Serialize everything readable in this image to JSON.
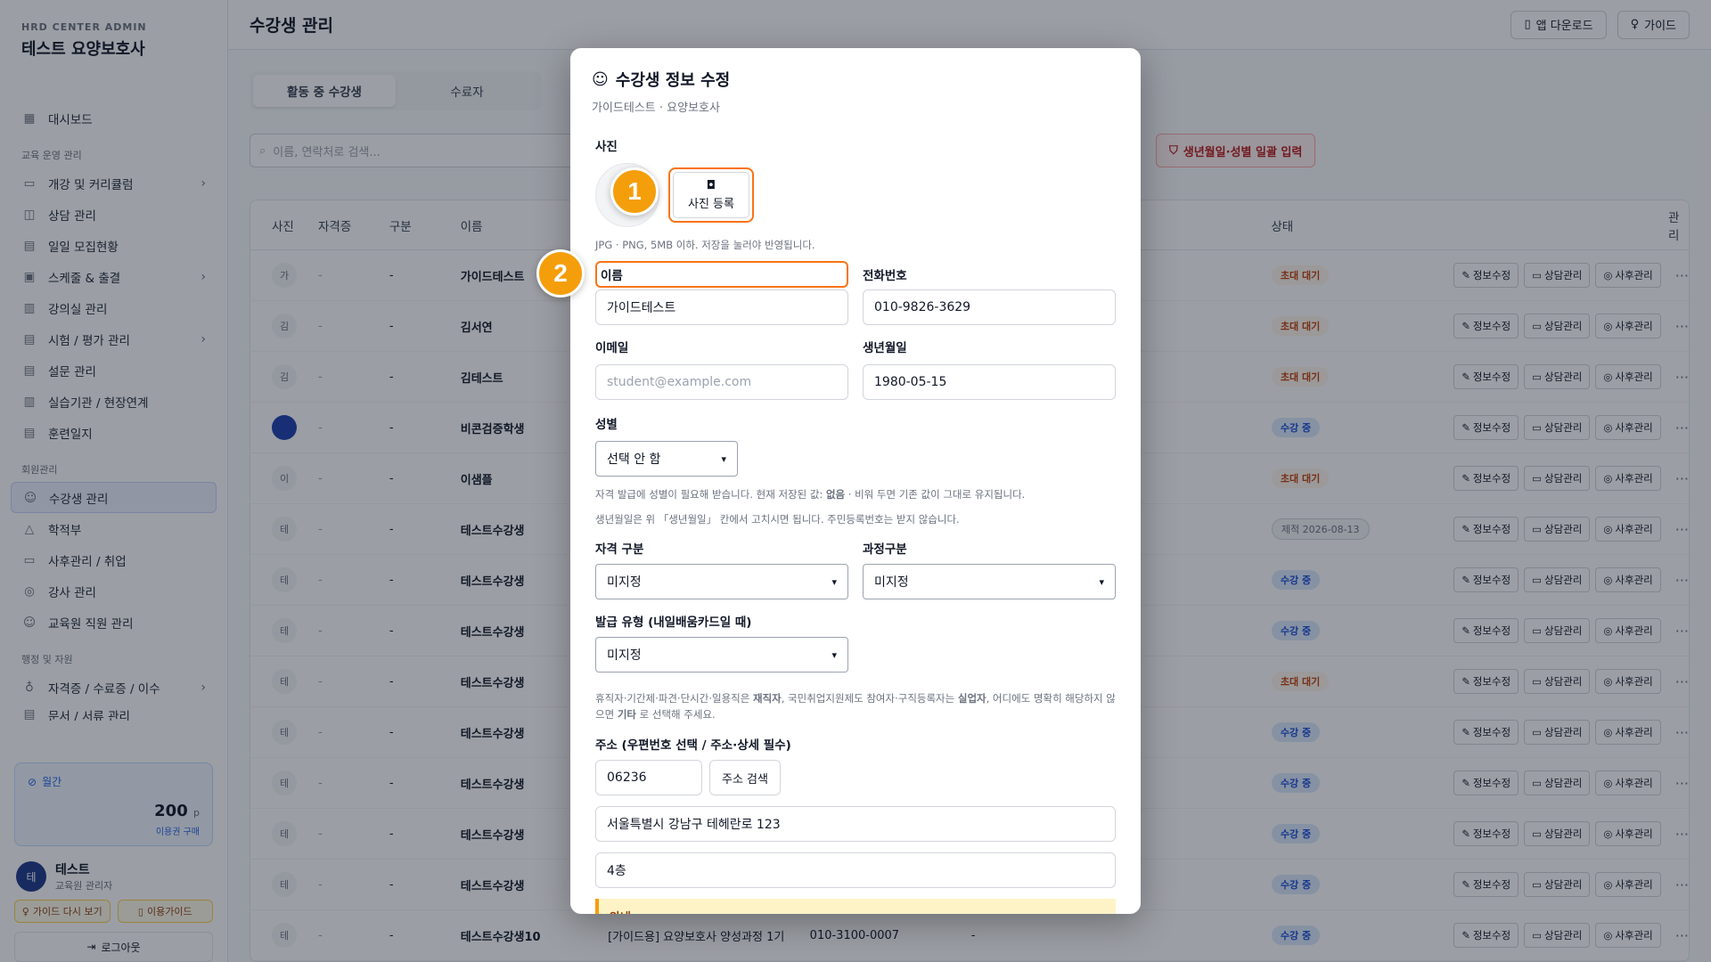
{
  "brand": {
    "sub": "HRD CENTER ADMIN",
    "title": "테스트 요양보호사"
  },
  "nav": {
    "dashboard": "대시보드",
    "group_edu": "교육 운영 관리",
    "course": "개강 및 커리큘럼",
    "consult": "상담 관리",
    "daily": "일일 모집현황",
    "schedule": "스케줄 & 출결",
    "classroom": "강의실 관리",
    "exam": "시험 / 평가 관리",
    "survey": "설문 관리",
    "practice": "실습기관 / 현장연계",
    "journal": "훈련일지",
    "group_member": "회원관리",
    "students": "수강생 관리",
    "registry": "학적부",
    "aftercare": "사후관리 / 취업",
    "instructors": "강사 관리",
    "staff": "교육원 직원 관리",
    "group_admin": "행정 및 자원",
    "certs": "자격증 / 수료증 / 이수",
    "docs": "문서 / 서류 관리"
  },
  "plan": {
    "label": "월간",
    "points": "200",
    "unit": "p",
    "link": "이용권 구매"
  },
  "user": {
    "initial": "테",
    "name": "테스트",
    "role": "교육원 관리자"
  },
  "sidebar_buttons": {
    "guide_again": "가이드 다시 보기",
    "usage_guide": "이용가이드",
    "logout": "로그아웃"
  },
  "header": {
    "title": "수강생 관리",
    "app_download": "앱 다운로드",
    "guide": "가이드"
  },
  "tabs": [
    "활동 중 수강생",
    "수료자"
  ],
  "search": {
    "placeholder": "이름, 연락처로 검색..."
  },
  "bulk_button": "생년월일·성별 일괄 입력",
  "table": {
    "headers": {
      "photo": "사진",
      "cert": "자격증",
      "div": "구분",
      "name": "이름",
      "status": "상태",
      "manage": "관리"
    },
    "actions": {
      "edit": "정보수정",
      "consult": "상담관리",
      "after": "사후관리",
      "more": "···"
    },
    "rows": [
      {
        "initial": "가",
        "cert": "-",
        "div": "-",
        "name": "가이드테스트",
        "course": "",
        "phone": "",
        "x": "",
        "status": "초대 대기",
        "kind": "wait"
      },
      {
        "initial": "김",
        "cert": "-",
        "div": "-",
        "name": "김서연",
        "course": "",
        "phone": "",
        "x": "",
        "status": "초대 대기",
        "kind": "wait"
      },
      {
        "initial": "김",
        "cert": "-",
        "div": "-",
        "name": "김테스트",
        "course": "",
        "phone": "",
        "x": "",
        "status": "초대 대기",
        "kind": "wait"
      },
      {
        "initial": "",
        "cert": "-",
        "div": "-",
        "name": "비콘검증학생",
        "course": "",
        "phone": "",
        "x": "",
        "status": "수강 중",
        "kind": "active",
        "blue": true
      },
      {
        "initial": "이",
        "cert": "-",
        "div": "-",
        "name": "이샘플",
        "course": "",
        "phone": "",
        "x": "",
        "status": "초대 대기",
        "kind": "wait"
      },
      {
        "initial": "테",
        "cert": "-",
        "div": "-",
        "name": "테스트수강생",
        "course": "",
        "phone": "",
        "x": "",
        "status": "제적 2026-08-13",
        "kind": "out"
      },
      {
        "initial": "테",
        "cert": "-",
        "div": "-",
        "name": "테스트수강생",
        "course": "",
        "phone": "",
        "x": "",
        "status": "수강 중",
        "kind": "active"
      },
      {
        "initial": "테",
        "cert": "-",
        "div": "-",
        "name": "테스트수강생",
        "course": "",
        "phone": "",
        "x": "",
        "status": "수강 중",
        "kind": "active"
      },
      {
        "initial": "테",
        "cert": "-",
        "div": "-",
        "name": "테스트수강생",
        "course": "",
        "phone": "",
        "x": "",
        "status": "초대 대기",
        "kind": "wait"
      },
      {
        "initial": "테",
        "cert": "-",
        "div": "-",
        "name": "테스트수강생",
        "course": "",
        "phone": "",
        "x": "",
        "status": "수강 중",
        "kind": "active"
      },
      {
        "initial": "테",
        "cert": "-",
        "div": "-",
        "name": "테스트수강생",
        "course": "",
        "phone": "",
        "x": "",
        "status": "수강 중",
        "kind": "active"
      },
      {
        "initial": "테",
        "cert": "-",
        "div": "-",
        "name": "테스트수강생",
        "course": "",
        "phone": "",
        "x": "",
        "status": "수강 중",
        "kind": "active"
      },
      {
        "initial": "테",
        "cert": "-",
        "div": "-",
        "name": "테스트수강생",
        "course": "",
        "phone": "",
        "x": "",
        "status": "수강 중",
        "kind": "active"
      },
      {
        "initial": "테",
        "cert": "-",
        "div": "-",
        "name": "테스트수강생10",
        "course": "[가이드용] 요양보호사 양성과정 1기",
        "phone": "010-3100-0007",
        "x": "-",
        "status": "수강 중",
        "kind": "active"
      }
    ]
  },
  "modal": {
    "title": "수강생 정보 수정",
    "subtitle": "가이드테스트 · 요양보호사",
    "photo_label": "사진",
    "photo_button": "사진 등록",
    "photo_hint": "JPG · PNG, 5MB 이하. 저장을 눌러야 반영됩니다.",
    "name_label": "이름",
    "name_value": "가이드테스트",
    "phone_label": "전화번호",
    "phone_value": "010-9826-3629",
    "email_label": "이메일",
    "email_placeholder": "student@example.com",
    "birth_label": "생년월일",
    "birth_value": "1980-05-15",
    "gender_label": "성별",
    "gender_value": "선택 안 함",
    "gender_hint_1": "자격 발급에 성별이 필요해 받습니다. 현재 저장된 값: ",
    "gender_hint_bold": "없음",
    "gender_hint_2": " · 비워 두면 기존 값이 그대로 유지됩니다.",
    "birth_hint": "생년월일은 위 「생년월일」 칸에서 고치시면 됩니다. 주민등록번호는 받지 않습니다.",
    "qual_label": "자격 구분",
    "qual_value": "미지정",
    "course_type_label": "과정구분",
    "course_type_value": "미지정",
    "issue_label": "발급 유형 (내일배움카드일 때)",
    "issue_value": "미지정",
    "employ_hint_a": "휴직자·기간제·파견·단시간·일용직은 ",
    "employ_hint_b1": "재직자",
    "employ_hint_c": ", 국민취업지원제도 참여자·구직등록자는 ",
    "employ_hint_b2": "실업자",
    "employ_hint_d": ", 어디에도 명확히 해당하지 않으면 ",
    "employ_hint_b3": "기타",
    "employ_hint_e": " 로 선택해 주세요.",
    "addr_label": "주소 (우편번호 선택 / 주소·상세 필수)",
    "zip_value": "06236",
    "addr_search": "주소 검색",
    "addr_value": "서울특별시 강남구 테헤란로 123",
    "addr_detail": "4층",
    "notice_title": "안내"
  },
  "markers": [
    "1",
    "2"
  ],
  "colors": {
    "highlight": "#f97316",
    "marker": "#f59e0b",
    "accent": "#2563eb"
  }
}
